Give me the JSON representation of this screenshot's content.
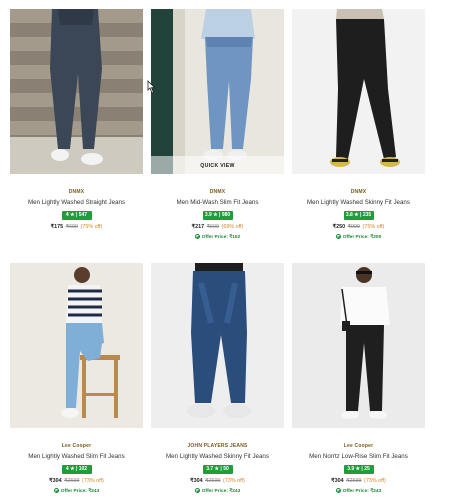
{
  "products": [
    {
      "brand": "DNMX",
      "name": "Men Lightly Washed Straight Jeans",
      "rating": "4 ★ | 547",
      "price": "₹175",
      "mrp": "₹699",
      "off": "(75% off)",
      "offer": ""
    },
    {
      "brand": "DNMX",
      "name": "Men Mid-Wash Slim Fit Jeans",
      "rating": "3.9 ★ | 980",
      "price": "₹217",
      "mrp": "₹699",
      "off": "(69% off)",
      "offer": "Offer Price: ₹152"
    },
    {
      "brand": "DNMX",
      "name": "Men Lightly Washed Skinny Fit Jeans",
      "rating": "3.8 ★ | 235",
      "price": "₹250",
      "mrp": "₹999",
      "off": "(75% off)",
      "offer": "Offer Price: ₹200"
    },
    {
      "brand": "Lee Cooper",
      "name": "Men Lightly Washed Slim Fit Jeans",
      "rating": "4 ★ | 102",
      "price": "₹304",
      "mrp": "₹2699",
      "off": "(73% off)",
      "offer": "Offer Price: ₹243"
    },
    {
      "brand": "JOHN PLAYERS JEANS",
      "name": "Men Lightly Washed Skinny Fit Jeans",
      "rating": "3.7 ★ | 50",
      "price": "₹304",
      "mrp": "₹2699",
      "off": "(73% off)",
      "offer": "Offer Price: ₹243"
    },
    {
      "brand": "Lee Cooper",
      "name": "Men Norrtz Low-Rise Slim Fit Jeans",
      "rating": "3.9 ★ | 25",
      "price": "₹304",
      "mrp": "₹2699",
      "off": "(73% off)",
      "offer": "Offer Price: ₹243"
    }
  ],
  "quick_view_label": "QUICK VIEW",
  "colors": {
    "rating_badge": "#1f9d3a",
    "brand_text": "#7a5a1a",
    "discount_text": "#d4862a",
    "offer_text": "#1a8a36"
  }
}
